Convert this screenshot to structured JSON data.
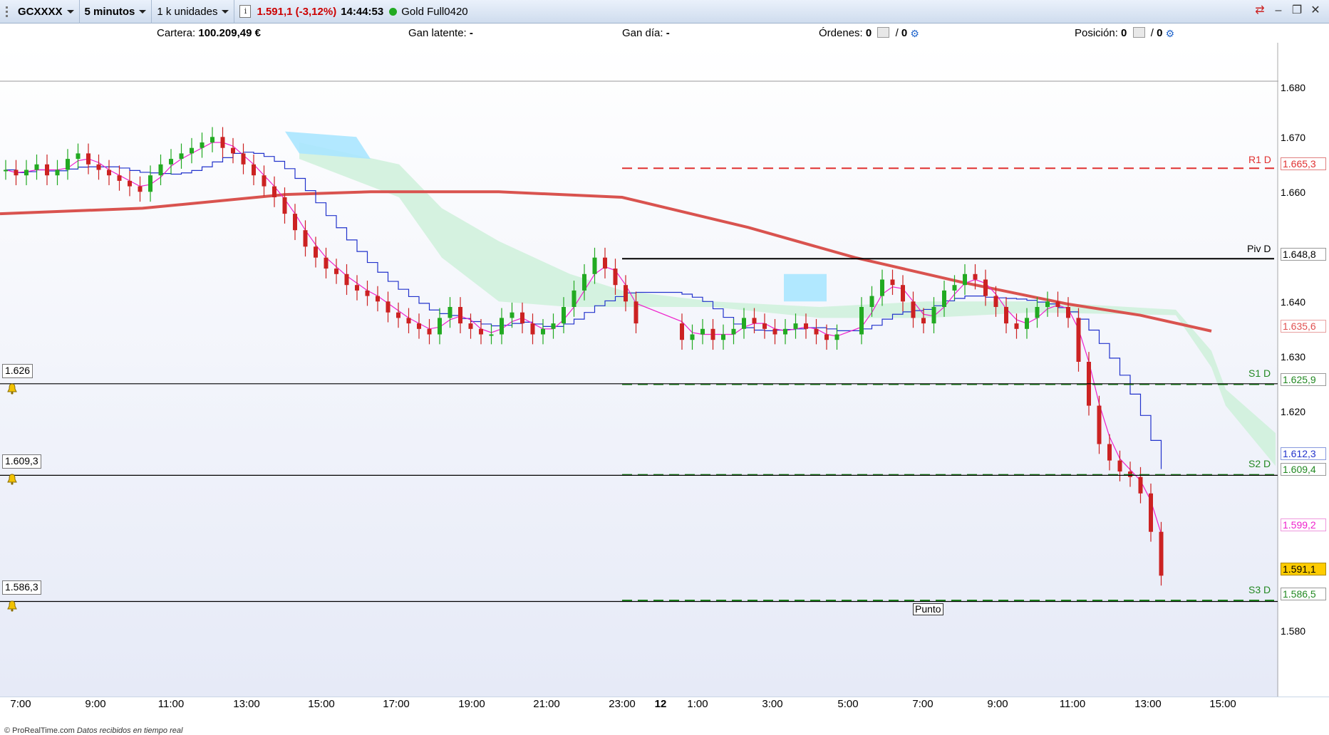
{
  "toolbar": {
    "symbol": "GCXXXX",
    "timeframe": "5 minutos",
    "units": "1 k unidades",
    "info_icon": "info-icon",
    "price_change": "1.591,1 (-3,12%)",
    "time": "14:44:53",
    "instrument": "Gold Full0420"
  },
  "summary": {
    "cartera_label": "Cartera:",
    "cartera_value": "100.209,49 €",
    "gan_latente_label": "Gan latente:",
    "gan_latente_value": "-",
    "gan_dia_label": "Gan día:",
    "gan_dia_value": "-",
    "ordenes_label": "Órdenes:",
    "ordenes_value": "0",
    "ordenes_sep": "/",
    "ordenes_value2": "0",
    "posicion_label": "Posición:",
    "posicion_value": "0",
    "posicion_sep": "/",
    "posicion_value2": "0"
  },
  "chart_data": {
    "type": "candlestick",
    "ylim": [
      1.575,
      1.683
    ],
    "y_ticks": [
      "1.680",
      "1.670",
      "1.660",
      "1.640",
      "1.630",
      "1.620",
      "1.580"
    ],
    "x_ticks": [
      "7:00",
      "9:00",
      "11:00",
      "13:00",
      "15:00",
      "17:00",
      "19:00",
      "21:00",
      "23:00",
      "12",
      "1:00",
      "3:00",
      "5:00",
      "7:00",
      "9:00",
      "11:00",
      "13:00",
      "15:00"
    ],
    "levels": [
      {
        "name": "R1 D",
        "value": "1.665,3",
        "price": 1665.3,
        "color": "#e03030",
        "style": "dashed"
      },
      {
        "name": "Piv D",
        "value": "1.648,8",
        "price": 1648.8,
        "color": "#000000",
        "style": "solid"
      },
      {
        "name": "S1 D",
        "value": "1.625,9",
        "price": 1625.9,
        "color": "#228822",
        "style": "dashed"
      },
      {
        "name": "S2 D",
        "value": "1.609,4",
        "price": 1609.4,
        "color": "#228822",
        "style": "dashed"
      },
      {
        "name": "S3 D",
        "value": "1.586,5",
        "price": 1586.5,
        "color": "#228822",
        "style": "dashed"
      }
    ],
    "price_markers": [
      {
        "value": "1.635,6",
        "color": "#e05050"
      },
      {
        "value": "1.612,3",
        "color": "#2233cc"
      },
      {
        "value": "1.599,2",
        "color": "#ee22cc"
      },
      {
        "value": "1.591,1",
        "color": "#000000",
        "bg": "#ffcc00"
      }
    ],
    "horizontal_lines": [
      {
        "label": "1.626",
        "price": 1626.0
      },
      {
        "label": "1.609,3",
        "price": 1609.3
      },
      {
        "label": "1.586,3",
        "price": 1586.3
      }
    ],
    "annotation": "Punto",
    "close_series": [
      1665,
      1664,
      1665,
      1666,
      1664,
      1665,
      1667,
      1668,
      1666,
      1665,
      1664,
      1663,
      1662,
      1661,
      1664,
      1666,
      1667,
      1668,
      1669,
      1670,
      1671,
      1669,
      1668,
      1666,
      1664,
      1662,
      1660,
      1657,
      1654,
      1651,
      1649,
      1647,
      1646,
      1644,
      1643,
      1642,
      1641,
      1639,
      1638,
      1637,
      1636,
      1635,
      1638,
      1640,
      1637,
      1636,
      1635,
      1635,
      1638,
      1639,
      1637,
      1635,
      1636,
      1637,
      1640,
      1643,
      1646,
      1649,
      1647,
      1644,
      1641,
      1637,
      1634,
      1635,
      1636,
      1634,
      1635,
      1636,
      1638,
      1637,
      1636,
      1635,
      1636,
      1637,
      1636,
      1635,
      1634,
      1635,
      1640,
      1642,
      1645,
      1644,
      1641,
      1638,
      1637,
      1640,
      1643,
      1644,
      1646,
      1645,
      1642,
      1640,
      1637,
      1636,
      1638,
      1640,
      1641,
      1640,
      1638,
      1630,
      1622,
      1615,
      1612,
      1610,
      1609,
      1606,
      1599,
      1591
    ],
    "indicators": [
      "ichimoku cloud",
      "moving average",
      "tenkan",
      "kijun"
    ]
  },
  "credit": {
    "source": "© ProRealTime.com",
    "note": "Datos recibidos en tiempo real"
  },
  "colors": {
    "ma": "#d9534f",
    "kijun": "#2233cc",
    "tenkan": "#ee22cc",
    "cloud_bull": "#ccf0d8",
    "cloud_bear": "#aae6ff",
    "up": "#22aa22",
    "down": "#cc2222"
  }
}
